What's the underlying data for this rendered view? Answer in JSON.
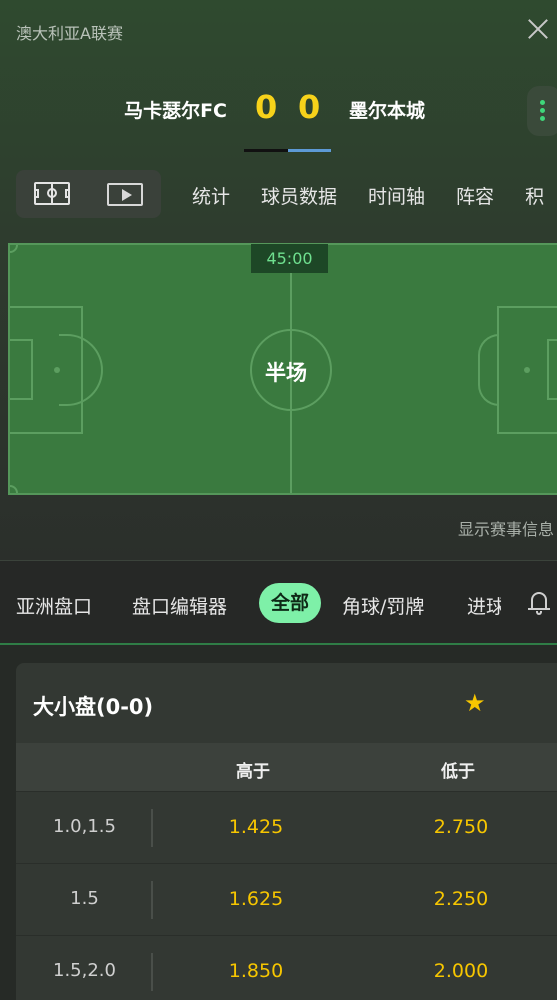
{
  "header": {
    "league": "澳大利亚A联赛",
    "home_team": "马卡瑟尔FC",
    "away_team": "墨尔本城",
    "home_score": "0",
    "away_score": "0"
  },
  "tabs_top": [
    "统计",
    "球员数据",
    "时间轴",
    "阵容",
    "积"
  ],
  "pitch": {
    "clock": "45:00",
    "status": "半场",
    "show_info": "显示赛事信息"
  },
  "market_tabs": [
    "亚洲盘口",
    "盘口编辑器",
    "全部",
    "角球/罚牌",
    "进球"
  ],
  "market": {
    "title": "大小盘(0-0)",
    "col_over": "高于",
    "col_under": "低于",
    "rows": [
      {
        "line": "1.0,1.5",
        "over": "1.425",
        "under": "2.750"
      },
      {
        "line": "1.5",
        "over": "1.625",
        "under": "2.250"
      },
      {
        "line": "1.5,2.0",
        "over": "1.850",
        "under": "2.000"
      }
    ]
  },
  "colors": {
    "score": "#f7d21a",
    "odds": "#f7c600",
    "active_tab": "#7ef0a8",
    "pitch": "#3a7a3f"
  },
  "icons": [
    "close-icon",
    "more-vertical-icon",
    "field-view-icon",
    "video-play-icon",
    "bell-icon",
    "star-icon"
  ]
}
